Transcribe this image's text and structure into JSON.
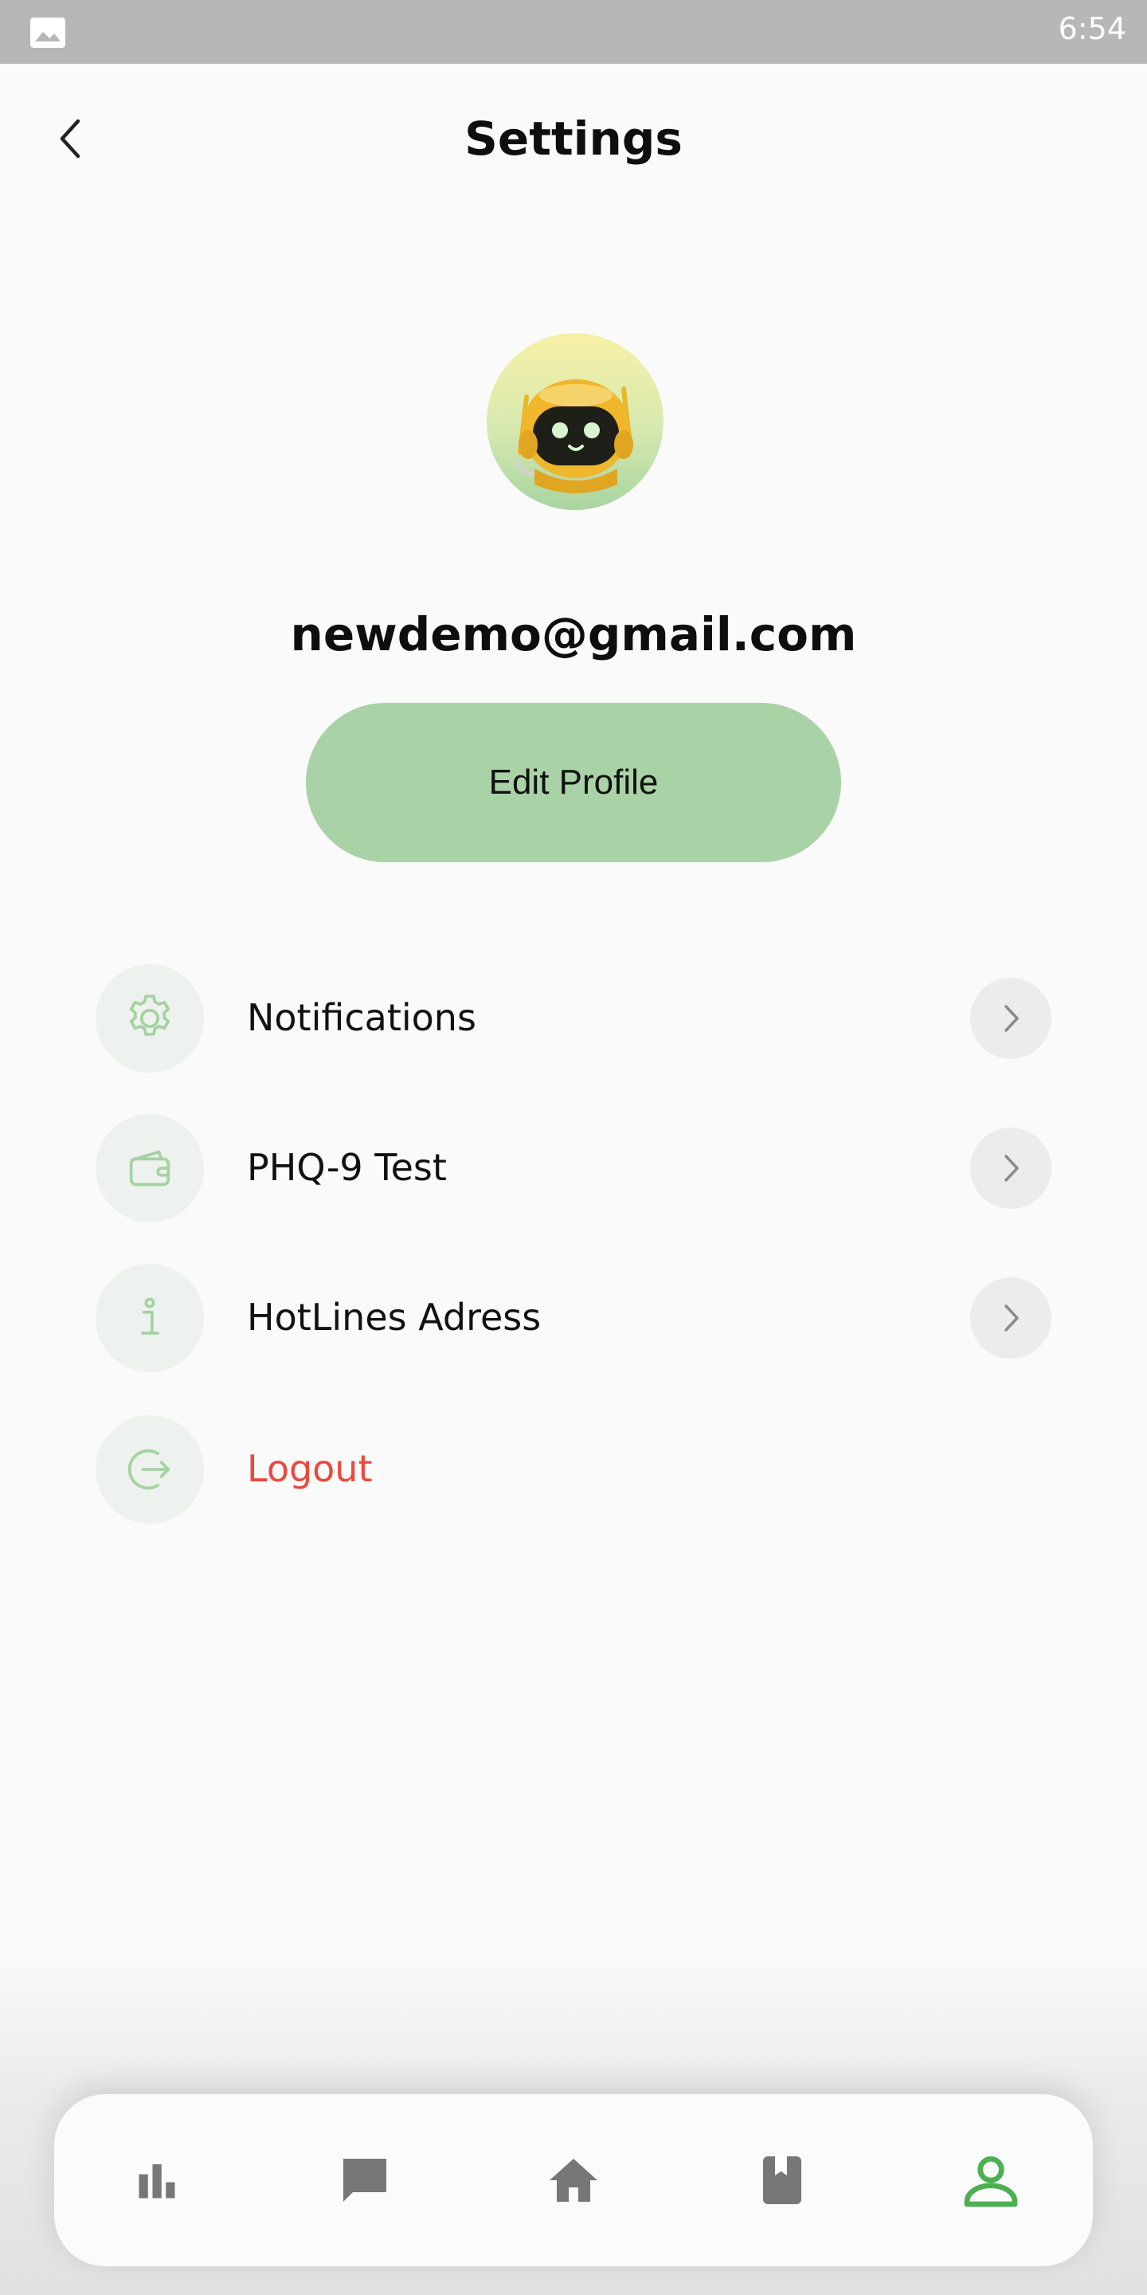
{
  "status_bar": {
    "time": "6:54"
  },
  "header": {
    "title": "Settings"
  },
  "profile": {
    "email": "newdemo@gmail.com",
    "edit_label": "Edit Profile"
  },
  "menu": {
    "items": [
      {
        "label": "Notifications",
        "icon": "gear-icon"
      },
      {
        "label": "PHQ-9 Test",
        "icon": "wallet-icon"
      },
      {
        "label": "HotLines Adress",
        "icon": "info-icon"
      },
      {
        "label": "Logout",
        "icon": "logout-icon"
      }
    ]
  },
  "bottom_nav": {
    "items": [
      "bar-chart-icon",
      "chat-icon",
      "home-icon",
      "bookmark-book-icon",
      "profile-icon"
    ],
    "active": "profile-icon"
  },
  "colors": {
    "accent": "#aad2a7",
    "icon_green": "#a5d2a2",
    "active_nav": "#4caf50",
    "logout_red": "#e84a3e",
    "nav_gray": "#777777"
  }
}
